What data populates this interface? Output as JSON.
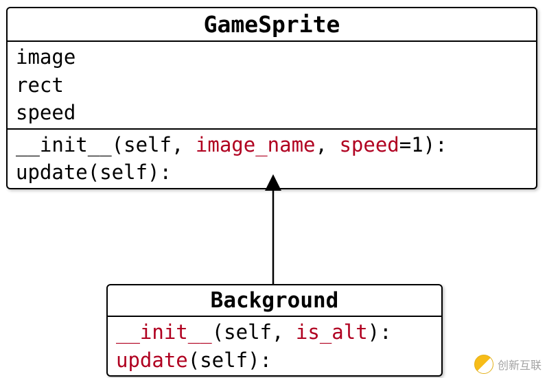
{
  "diagram_type": "uml_class_diagram",
  "classes": {
    "gamesprite": {
      "name": "GameSprite",
      "attributes": [
        "image",
        "rect",
        "speed"
      ],
      "methods": [
        {
          "tokens": [
            {
              "t": "__init__(self, ",
              "c": "black"
            },
            {
              "t": "image_name",
              "c": "red"
            },
            {
              "t": ", ",
              "c": "black"
            },
            {
              "t": "speed",
              "c": "red"
            },
            {
              "t": "=1):",
              "c": "black"
            }
          ]
        },
        {
          "tokens": [
            {
              "t": "update(self):",
              "c": "black"
            }
          ]
        }
      ]
    },
    "background": {
      "name": "Background",
      "attributes": [],
      "methods": [
        {
          "tokens": [
            {
              "t": "__init__",
              "c": "red"
            },
            {
              "t": "(self, ",
              "c": "black"
            },
            {
              "t": "is_alt",
              "c": "red"
            },
            {
              "t": "):",
              "c": "black"
            }
          ]
        },
        {
          "tokens": [
            {
              "t": "update",
              "c": "red"
            },
            {
              "t": "(self):",
              "c": "black"
            }
          ]
        }
      ]
    }
  },
  "inheritance": {
    "child": "background",
    "parent": "gamesprite"
  },
  "watermark": {
    "text": "创新互联"
  }
}
